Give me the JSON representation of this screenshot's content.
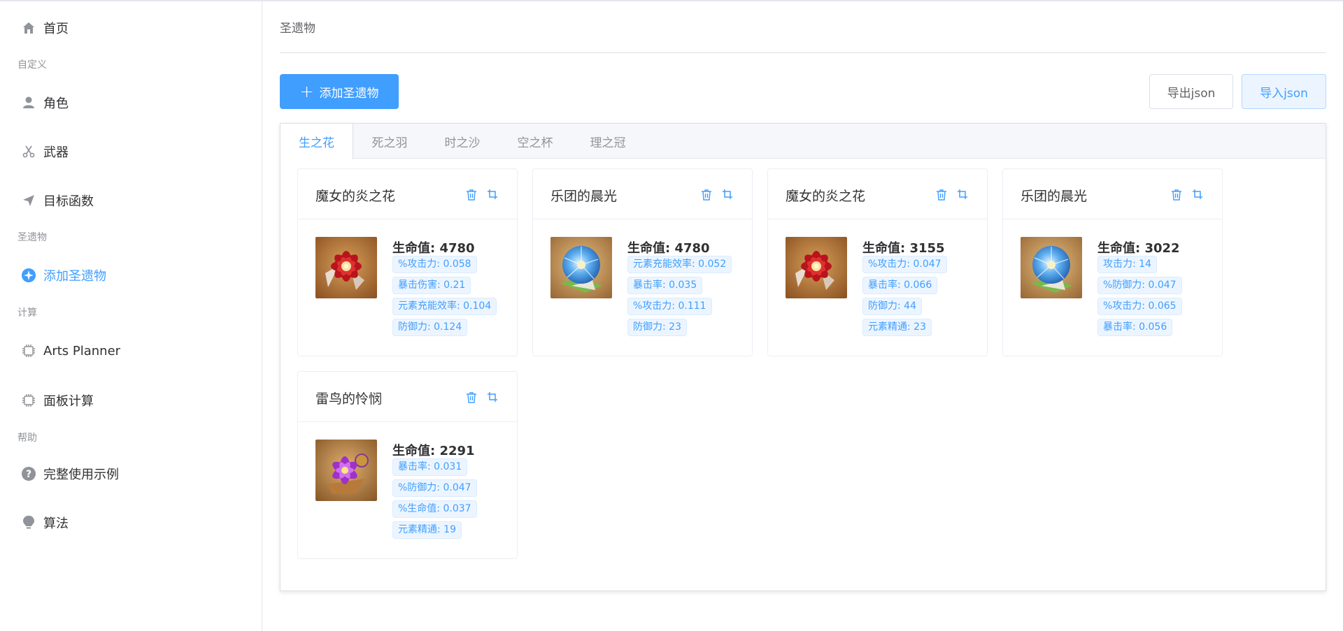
{
  "sidebar": {
    "home": "首页",
    "group_custom": "自定义",
    "character": "角色",
    "weapon": "武器",
    "target": "目标函数",
    "group_artifact": "圣遗物",
    "add_artifact": "添加圣遗物",
    "group_calc": "计算",
    "arts_planner": "Arts Planner",
    "panel_calc": "面板计算",
    "group_help": "帮助",
    "example": "完整使用示例",
    "algorithm": "算法"
  },
  "main": {
    "breadcrumb": "圣遗物",
    "add_button": "添加圣遗物",
    "add_button_icon": "+",
    "export_button": "导出json",
    "import_button": "导入json",
    "tabs": [
      {
        "label": "生之花"
      },
      {
        "label": "死之羽"
      },
      {
        "label": "时之沙"
      },
      {
        "label": "空之杯"
      },
      {
        "label": "理之冠"
      }
    ],
    "active_tab": "生之花",
    "artifacts": [
      {
        "name": "魔女的炎之花",
        "icon": "crimson-witch-flower",
        "main_stat": "生命值: 4780",
        "sub_stats": [
          "%攻击力: 0.058",
          "暴击伤害: 0.21",
          "元素充能效率: 0.104",
          "防御力: 0.124"
        ]
      },
      {
        "name": "乐团的晨光",
        "icon": "wanderers-troupe-flower",
        "main_stat": "生命值: 4780",
        "sub_stats": [
          "元素充能效率: 0.052",
          "暴击率: 0.035",
          "%攻击力: 0.111",
          "防御力: 23"
        ]
      },
      {
        "name": "魔女的炎之花",
        "icon": "crimson-witch-flower",
        "main_stat": "生命值: 3155",
        "sub_stats": [
          "%攻击力: 0.047",
          "暴击率: 0.066",
          "防御力: 44",
          "元素精通: 23"
        ]
      },
      {
        "name": "乐团的晨光",
        "icon": "wanderers-troupe-flower",
        "main_stat": "生命值: 3022",
        "sub_stats": [
          "攻击力: 14",
          "%防御力: 0.047",
          "%攻击力: 0.065",
          "暴击率: 0.056"
        ]
      },
      {
        "name": "雷鸟的怜悯",
        "icon": "thundersoother-flower",
        "main_stat": "生命值: 2291",
        "sub_stats": [
          "暴击率: 0.031",
          "%防御力: 0.047",
          "%生命值: 0.037",
          "元素精通: 19"
        ]
      }
    ]
  },
  "colors": {
    "primary": "#409eff",
    "primary_light": "#ecf5ff",
    "text": "#303133",
    "muted": "#909399"
  }
}
